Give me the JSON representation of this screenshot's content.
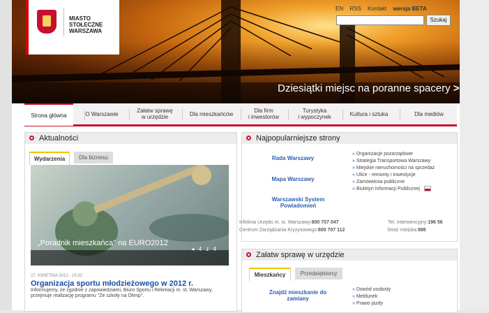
{
  "header": {
    "logo_line1": "MIASTO",
    "logo_line2": "STOŁECZNE",
    "logo_line3": "WARSZAWA",
    "top_links": [
      "EN",
      "RSS",
      "Kontakt"
    ],
    "beta_label": "wersja BETA",
    "search_button": "Szukaj",
    "hero_title": "Dziesiątki miejsc na poranne spacery",
    "hero_arrow": ">"
  },
  "nav": {
    "items": [
      {
        "label": "Strona główna"
      },
      {
        "label": "O Warszawie"
      },
      {
        "label": "Załatw sprawę\nw urzędzie"
      },
      {
        "label": "Dla mieszkańców"
      },
      {
        "label": "Dla firm\ni inwestorów"
      },
      {
        "label": "Turystyka\ni wypoczynek"
      },
      {
        "label": "Kultura i sztuka"
      },
      {
        "label": "Dla mediów"
      }
    ]
  },
  "news": {
    "title": "Aktualności",
    "tabs": [
      "Wydarzenia",
      "Dla biznesu"
    ],
    "slide_caption": "„Poradnik mieszkańca\" na EURO2012",
    "slide_counter": "4 z 4",
    "date": "27. KWIETNIA 2012 - 15:32",
    "headline": "Organizacja sportu młodzieżowego w 2012 r.",
    "body": "Informujemy, że zgodnie z zapowiedziami, Biuro Sportu i Rekreacji m. st. Warszawy, przejmuje realizację programu \"Ze szkoły na Olimp\"."
  },
  "popular": {
    "title": "Najpopularniejsze strony",
    "left_links": [
      "Rada Warszawy",
      "Mapa Warszawy",
      "Warszawski System\nPowiadomień"
    ],
    "right_links": [
      "Organizacje pozarządowe",
      "Strategia Transportowa Warszawy",
      "Miejskie nieruchomości na sprzedaż",
      "Ulice - remonty i inwestycje",
      "Zamówienia publiczne",
      "Biuletyn Informacji Publicznej"
    ],
    "contact_left1_label": "Infolinia Urzędu m. st. Warszawy:",
    "contact_left1_value": "800 707 047",
    "contact_left2_label": "Centrum Zarządzania Kryzysowego:",
    "contact_left2_value": "800 707 112",
    "contact_right1_label": "Tel. interwencyjny:",
    "contact_right1_value": "196 56",
    "contact_right2_label": "Straż miejska:",
    "contact_right2_value": "986"
  },
  "services": {
    "title": "Załatw sprawę w urzędzie",
    "tabs": [
      "Mieszkańcy",
      "Przedsiębiorcy"
    ],
    "left_link": "Znajdź mieszkanie do\nzamiany",
    "right_links": [
      "Dowód osobisty",
      "Meldunek",
      "Prawo jazdy"
    ]
  },
  "colors": {
    "accent": "#c8102e",
    "link": "#2a5fb0"
  }
}
